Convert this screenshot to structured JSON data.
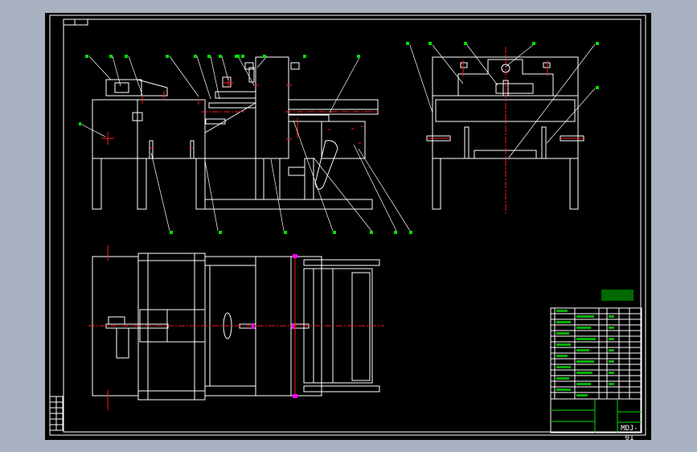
{
  "window": {
    "background": "#a7b1bf",
    "canvas_background": "#000000"
  },
  "colors": {
    "geometry": "#ffffff",
    "centerline": "#ff1a1a",
    "labels": "#00e000",
    "highlight": "#ff00ff"
  },
  "title_block": {
    "drawing_number": "MDJ-01"
  },
  "views": [
    "front-view",
    "side-view",
    "top-view"
  ]
}
